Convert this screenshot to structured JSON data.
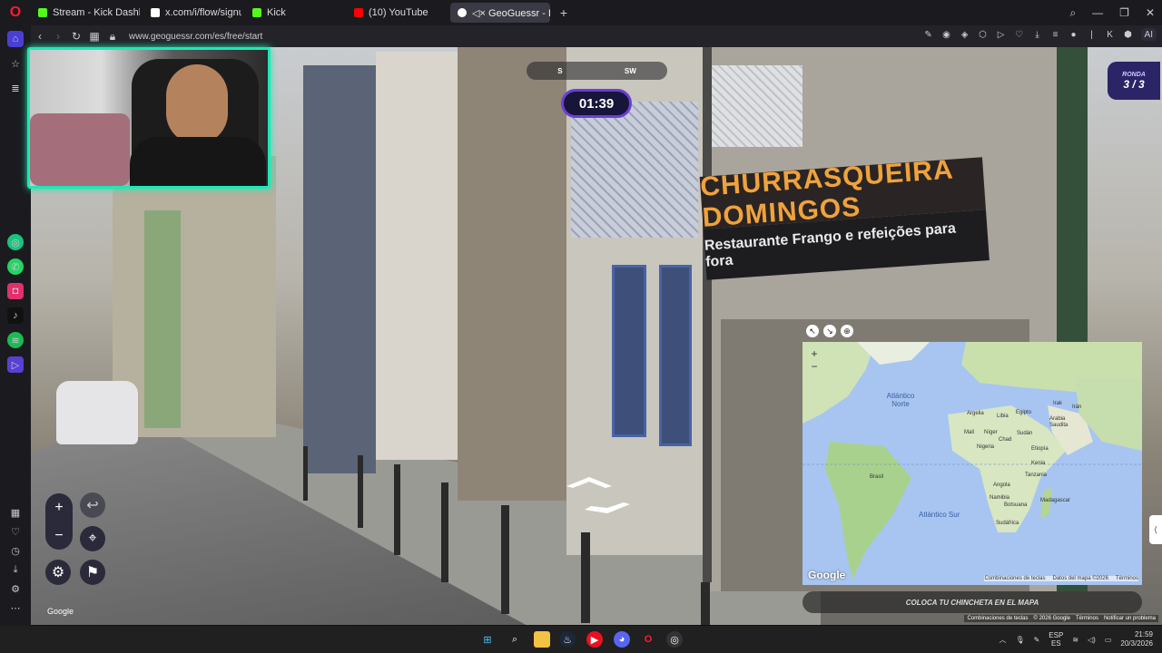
{
  "browser": {
    "tabs": [
      {
        "label": "Stream - Kick Dashboard",
        "color": "#53fc18"
      },
      {
        "label": "x.com/i/flow/signup",
        "color": "#ffffff"
      },
      {
        "label": "Kick",
        "color": "#53fc18"
      },
      {
        "label": "(10) YouTube",
        "color": "#ff0000"
      },
      {
        "label": "◁× GeoGuessr - Let's exp",
        "color": "#ffffff"
      }
    ],
    "new_tab": "+",
    "url": "www.geoguessr.com/es/free/start",
    "aria_label": "AI"
  },
  "streetview": {
    "sign_top": "CHURRASQUEIRA DOMINGOS",
    "sign_bottom": "Restaurante  Frango e refeições para fora",
    "google": "Google",
    "footer": [
      "Combinaciones de teclas",
      "© 2026 Google",
      "Términos",
      "Notificar un problema"
    ]
  },
  "game": {
    "compass": [
      "S",
      "SW"
    ],
    "timer": "01:39",
    "round_label": "RONDA",
    "round_value": "3 / 3"
  },
  "map": {
    "oceans": [
      "Atlántico Norte",
      "Atlántico Sur"
    ],
    "countries": [
      "Argelia",
      "Libia",
      "Egipto",
      "Irak",
      "Irán",
      "Arabia Saudita",
      "Malí",
      "Níger",
      "Chad",
      "Sudán",
      "Nigeria",
      "Etiopía",
      "Kenia",
      "Tanzania",
      "Angola",
      "Namibia",
      "Botsuana",
      "Madagascar",
      "Sudáfrica",
      "Brasil"
    ],
    "google": "Google",
    "footer": [
      "Combinaciones de teclas",
      "Datos del mapa ©2026",
      "Términos"
    ],
    "place_pin": "COLOCA TU CHINCHETA EN EL MAPA"
  },
  "taskbar": {
    "lang_top": "ESP",
    "lang_bottom": "ES",
    "time": "21:59",
    "date": "20/3/2026"
  }
}
